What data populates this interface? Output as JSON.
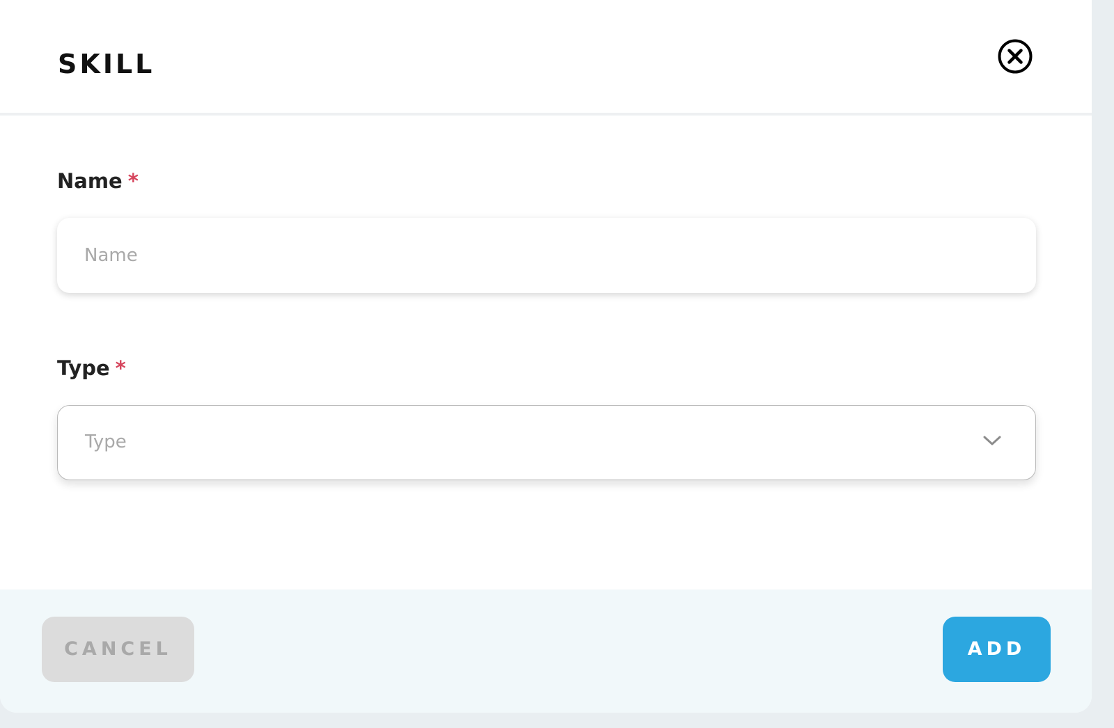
{
  "dialog": {
    "title": "SKILL"
  },
  "form": {
    "name": {
      "label": "Name",
      "required_marker": "*",
      "placeholder": "Name",
      "value": ""
    },
    "type": {
      "label": "Type",
      "required_marker": "*",
      "placeholder": "Type",
      "selected": ""
    }
  },
  "footer": {
    "cancel_label": "CANCEL",
    "add_label": "ADD"
  },
  "icons": {
    "close": "close-circle-icon",
    "dropdown": "chevron-down-icon"
  },
  "colors": {
    "accent": "#2ca7e0",
    "required": "#d6455d",
    "cancel_bg": "#dcdcdc",
    "footer_bg": "#f1f8fa"
  }
}
